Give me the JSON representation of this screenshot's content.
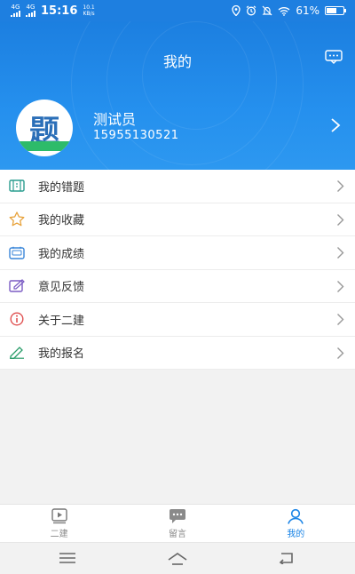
{
  "status_bar": {
    "signal_1": "4G",
    "signal_2": "4G",
    "time": "15:16",
    "speed_value": "10.1",
    "speed_unit": "KB/s",
    "battery": "61%",
    "battery_level": 0.61
  },
  "header": {
    "title": "我的",
    "message_icon": "chat-bubble-icon"
  },
  "profile": {
    "avatar_text": "题",
    "name": "测试员",
    "phone": "15955130521"
  },
  "menu": {
    "items": [
      {
        "label": "我的错题",
        "icon": "wrong-questions-icon"
      },
      {
        "label": "我的收藏",
        "icon": "star-icon"
      },
      {
        "label": "我的成绩",
        "icon": "score-icon"
      },
      {
        "label": "意见反馈",
        "icon": "feedback-icon"
      },
      {
        "label": "关于二建",
        "icon": "info-icon"
      },
      {
        "label": "我的报名",
        "icon": "pen-icon"
      }
    ]
  },
  "tabbar": {
    "tabs": [
      {
        "label": "二建",
        "icon": "video-icon"
      },
      {
        "label": "留言",
        "icon": "message-icon"
      },
      {
        "label": "我的",
        "icon": "person-icon"
      }
    ],
    "active_index": 2
  },
  "colors": {
    "primary": "#1a84e6",
    "header_bg": "#1e7fe0"
  }
}
